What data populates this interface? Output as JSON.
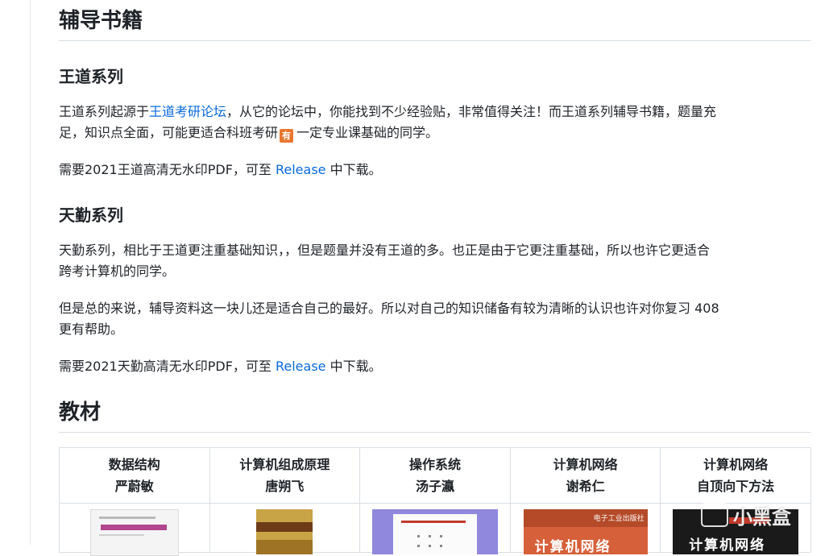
{
  "section1": {
    "heading": "辅导书籍",
    "wangdao": {
      "heading": "王道系列",
      "p1_before": "王道系列起源于",
      "p1_link": "王道考研论坛",
      "p1_after": "，从它的论坛中，你能找到不少经验贴，非常值得关注！而王道系列辅导书籍，题量充",
      "p1_line2a": "足，知识点全面，可能更适合科班考研",
      "p1_emoji": "有",
      "p1_line2b": "一定专业课基础的同学。",
      "p2_before": "需要2021王道高清无水印PDF，可至 ",
      "p2_link": "Release",
      "p2_after": " 中下载。"
    },
    "tianqin": {
      "heading": "天勤系列",
      "p1_line1": "天勤系列，相比于王道更注重基础知识，，但是题量并没有王道的多。也正是由于它更注重基础，所以也许它更适合",
      "p1_line2": "跨考计算机的同学。",
      "p2_line1": "但是总的来说，辅导资料这一块儿还是适合自己的最好。所以对自己的知识储备有较为清晰的认识也许对你复习 408",
      "p2_line2": "更有帮助。",
      "p3_before": "需要2021天勤高清无水印PDF，可至 ",
      "p3_link": "Release",
      "p3_after": " 中下载。"
    }
  },
  "section2": {
    "heading": "教材",
    "columns": [
      {
        "subject": "数据结构",
        "author": "严蔚敏"
      },
      {
        "subject": "计算机组成原理",
        "author": "唐朔飞"
      },
      {
        "subject": "操作系统",
        "author": "汤子瀛"
      },
      {
        "subject": "计算机网络",
        "author": "谢希仁"
      },
      {
        "subject": "计算机网络",
        "author": "自顶向下方法"
      }
    ],
    "cover4_title": "计算机网络",
    "cover4_publisher": "电子工业出版社",
    "cover5_title": "计算机网络"
  },
  "watermark": {
    "text": "小黑盒"
  },
  "colors": {
    "link": "#0969da",
    "text": "#1f2328",
    "border": "#d8dee4"
  }
}
